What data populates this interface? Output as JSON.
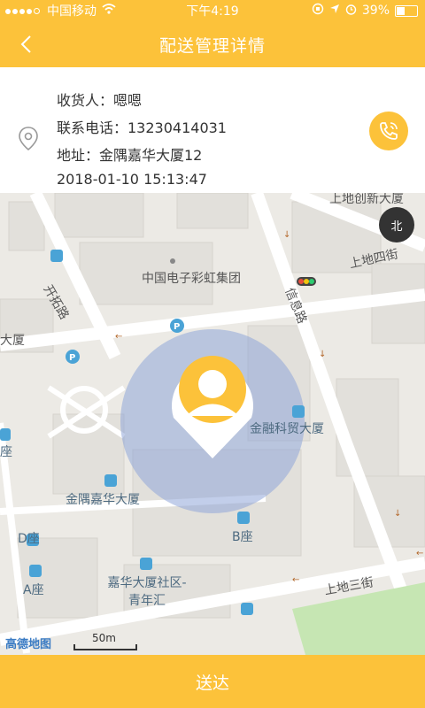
{
  "status_bar": {
    "carrier": "中国移动",
    "time": "下午4:19",
    "battery": "39%",
    "battery_level": 0.39
  },
  "nav": {
    "title": "配送管理详情"
  },
  "receiver": {
    "name_line": "收货人：嗯嗯",
    "phone_line": "联系电话：13230414031",
    "address_line": "地址：金隅嘉华大厦12",
    "time_line": "2018-01-10 15:13:47"
  },
  "map": {
    "labels": {
      "road_kaituo": "开拓路",
      "road_xinxi": "信息路",
      "road_shangdi_3": "上地三街",
      "road_shangdi_4": "上地四街",
      "road_shangdi_top": "上地创新大厦",
      "cec": "中国电子彩虹集团",
      "jinrong": "金融科贸大厦",
      "jinyu": "金隅嘉华大厦",
      "d_zuo": "D座",
      "a_zuo": "A座",
      "b_zuo": "B座",
      "jiahua": "嘉华大厦社区-青年汇",
      "dasha_left": "大厦",
      "zuo_left": "座"
    },
    "compass": "北",
    "scale": "50m",
    "logo": "高德地图"
  },
  "footer": {
    "deliver_label": "送达"
  },
  "colors": {
    "accent": "#fcc23a",
    "map_bg": "#eceae5",
    "circle": "#8fa5d8"
  }
}
